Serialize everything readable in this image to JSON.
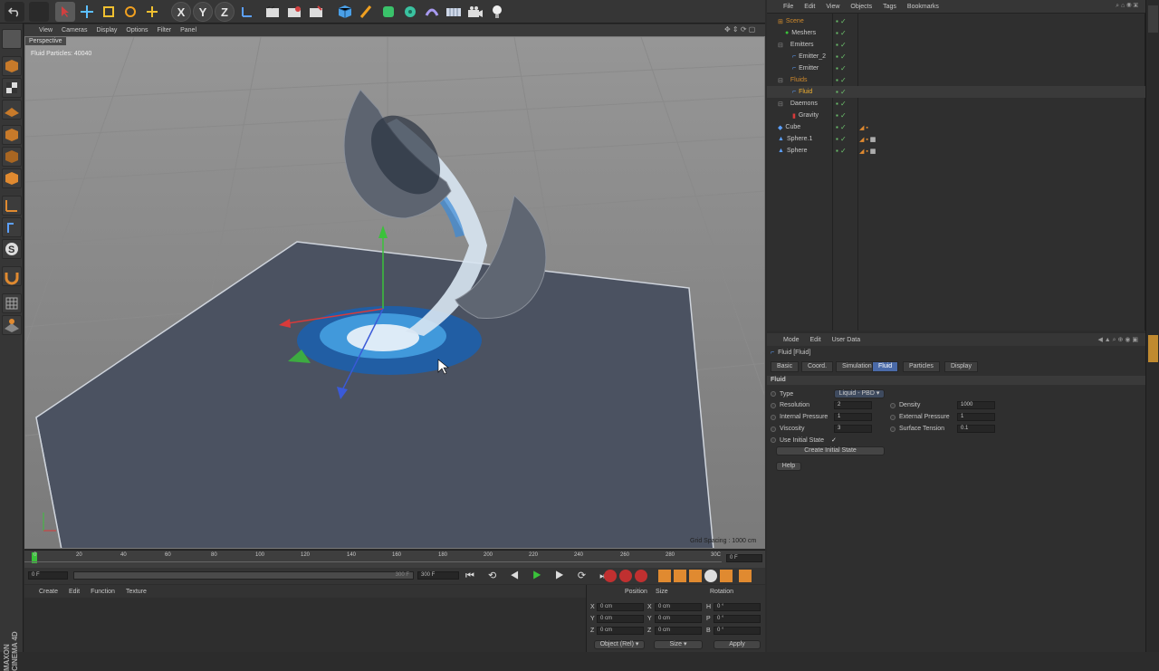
{
  "viewport": {
    "menu": [
      "View",
      "Cameras",
      "Display",
      "Options",
      "Filter",
      "Panel"
    ],
    "label": "Perspective",
    "stat": "Fluid Particles: 40040",
    "grid_spacing": "Grid Spacing : 1000 cm"
  },
  "toolbar": {
    "x_label": "X",
    "y_label": "Y",
    "z_label": "Z"
  },
  "timeline": {
    "ticks": [
      "0",
      "20",
      "40",
      "60",
      "80",
      "100",
      "120",
      "140",
      "160",
      "180",
      "200",
      "220",
      "240",
      "260",
      "280",
      "30C"
    ],
    "end_field": "0 F",
    "start_frame": "0 F",
    "range_end": "300 F",
    "max_frame": "300 F"
  },
  "material_menu": [
    "Create",
    "Edit",
    "Function",
    "Texture"
  ],
  "coordinates": {
    "headers": [
      "Position",
      "Size",
      "Rotation"
    ],
    "rows": [
      {
        "axis": "X",
        "pos": "0 cm",
        "size_axis": "X",
        "size": "0 cm",
        "rot_axis": "H",
        "rot": "0 °"
      },
      {
        "axis": "Y",
        "pos": "0 cm",
        "size_axis": "Y",
        "size": "0 cm",
        "rot_axis": "P",
        "rot": "0 °"
      },
      {
        "axis": "Z",
        "pos": "0 cm",
        "size_axis": "Z",
        "size": "0 cm",
        "rot_axis": "B",
        "rot": "0 °"
      }
    ],
    "mode": "Object (Rel)",
    "size_mode": "Size",
    "apply": "Apply"
  },
  "object_manager": {
    "menu": [
      "File",
      "Edit",
      "View",
      "Objects",
      "Tags",
      "Bookmarks"
    ],
    "objects": [
      {
        "name": "Scene",
        "color": "#d08a2c"
      },
      {
        "name": "Meshers",
        "color": "#c8c8c8"
      },
      {
        "name": "Emitters",
        "color": "#c8c8c8"
      },
      {
        "name": "Emitter_2",
        "color": "#c8c8c8"
      },
      {
        "name": "Emitter",
        "color": "#c8c8c8"
      },
      {
        "name": "Fluids",
        "color": "#d08a2c"
      },
      {
        "name": "Fluid",
        "color": "#f0b030"
      },
      {
        "name": "Daemons",
        "color": "#c8c8c8"
      },
      {
        "name": "Gravity",
        "color": "#c8c8c8"
      },
      {
        "name": "Cube",
        "color": "#c8c8c8"
      },
      {
        "name": "Sphere.1",
        "color": "#c8c8c8"
      },
      {
        "name": "Sphere",
        "color": "#c8c8c8"
      }
    ]
  },
  "attributes": {
    "menu": [
      "Mode",
      "Edit",
      "User Data"
    ],
    "title": "Fluid [Fluid]",
    "tabs": [
      "Basic",
      "Coord.",
      "Simulation",
      "Fluid",
      "Particles",
      "Display"
    ],
    "section": "Fluid",
    "type_label": "Type",
    "type_value": "Liquid - PBD",
    "left_params": [
      {
        "label": "Resolution",
        "value": "2"
      },
      {
        "label": "Internal Pressure",
        "value": "1"
      },
      {
        "label": "Viscosity",
        "value": "3"
      }
    ],
    "right_params": [
      {
        "label": "Density",
        "value": "1000"
      },
      {
        "label": "External Pressure",
        "value": "1"
      },
      {
        "label": "Surface Tension",
        "value": "0.1"
      }
    ],
    "use_initial_state": "Use Initial State",
    "create_initial_state": "Create Initial State",
    "help": "Help"
  },
  "branding": "MAXON CINEMA 4D",
  "colors": {
    "accent": "#4a6aa8",
    "x_axis": "#d83a3a",
    "y_axis": "#3ac23a",
    "z_axis": "#3a5ad8",
    "fluid": "#2a78c8"
  }
}
